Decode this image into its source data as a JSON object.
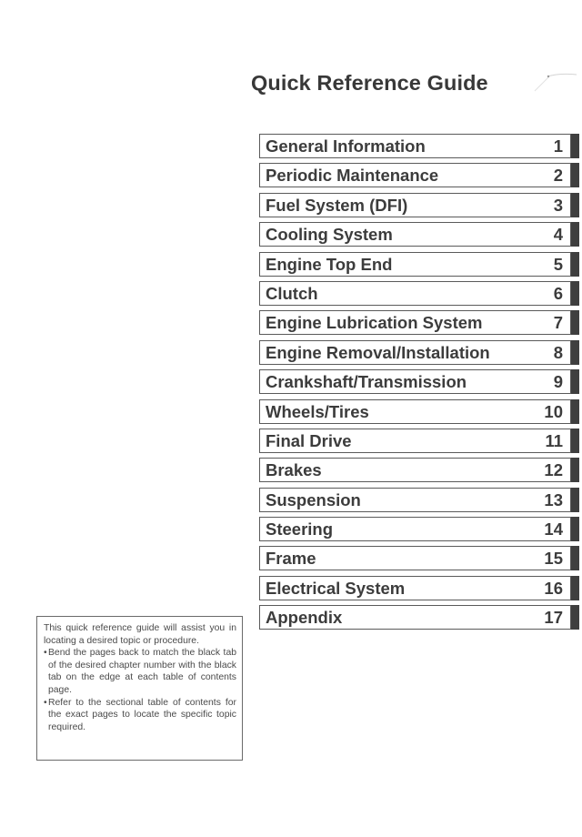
{
  "page": {
    "title": "Quick Reference Guide"
  },
  "toc": {
    "items": [
      {
        "label": "General Information",
        "number": "1"
      },
      {
        "label": "Periodic Maintenance",
        "number": "2"
      },
      {
        "label": "Fuel System (DFI)",
        "number": "3"
      },
      {
        "label": "Cooling System",
        "number": "4"
      },
      {
        "label": "Engine Top End",
        "number": "5"
      },
      {
        "label": "Clutch",
        "number": "6"
      },
      {
        "label": "Engine Lubrication System",
        "number": "7"
      },
      {
        "label": "Engine Removal/Installation",
        "number": "8"
      },
      {
        "label": "Crankshaft/Transmission",
        "number": "9"
      },
      {
        "label": "Wheels/Tires",
        "number": "10"
      },
      {
        "label": "Final Drive",
        "number": "11"
      },
      {
        "label": "Brakes",
        "number": "12"
      },
      {
        "label": "Suspension",
        "number": "13"
      },
      {
        "label": "Steering",
        "number": "14"
      },
      {
        "label": "Frame",
        "number": "15"
      },
      {
        "label": "Electrical System",
        "number": "16"
      },
      {
        "label": "Appendix",
        "number": "17"
      }
    ],
    "tab_color": "#3f3f3f",
    "border_color": "#5a5a5a"
  },
  "note": {
    "intro": "This quick reference guide will assist you in locating a desired topic or pro­cedure.",
    "bullet_mark": "•",
    "bullets": [
      "Bend the pages back to match the black tab of the desired chapter num­ber with the black tab on the edge at each table of contents page.",
      "Refer to the sectional table of contents for the exact pages to locate the spe­cific topic required."
    ]
  }
}
